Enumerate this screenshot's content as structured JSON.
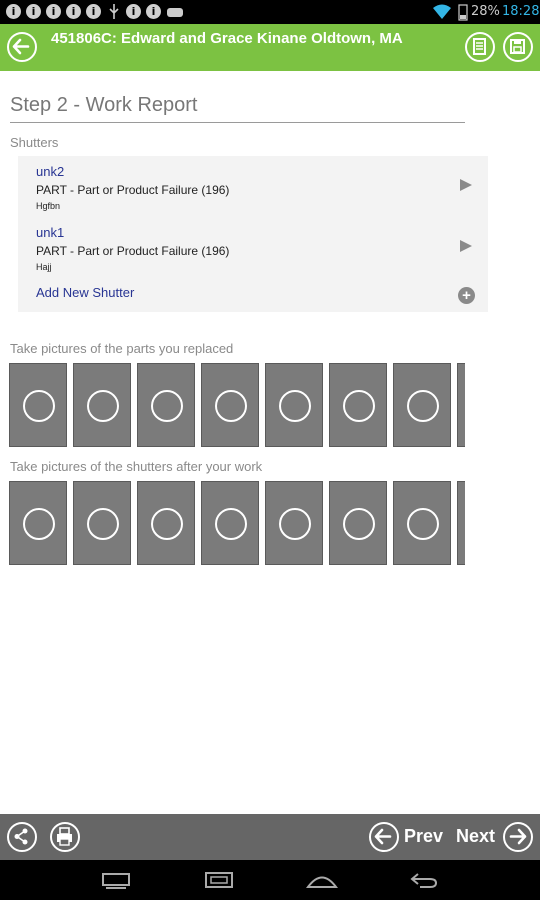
{
  "status_bar": {
    "battery": "28%",
    "time": "18:28"
  },
  "header": {
    "title": "451806C: Edward  and  Grace Kinane Oldtown, MA"
  },
  "step": {
    "title": "Step 2 - Work Report"
  },
  "shutters": {
    "label": "Shutters",
    "items": [
      {
        "name": "unk2",
        "reason": "PART - Part or Product Failure (196)",
        "note": "Hgfbn"
      },
      {
        "name": "unk1",
        "reason": "PART - Part or Product Failure (196)",
        "note": "Hajj"
      }
    ],
    "add_label": "Add New Shutter"
  },
  "photos": {
    "replaced_label": "Take pictures of the parts you replaced",
    "after_label": "Take pictures of the shutters after your work"
  },
  "bottom": {
    "prev_label": "Prev",
    "next_label": "Next"
  },
  "colors": {
    "header_green": "#7cc242",
    "link_blue": "#283593"
  }
}
